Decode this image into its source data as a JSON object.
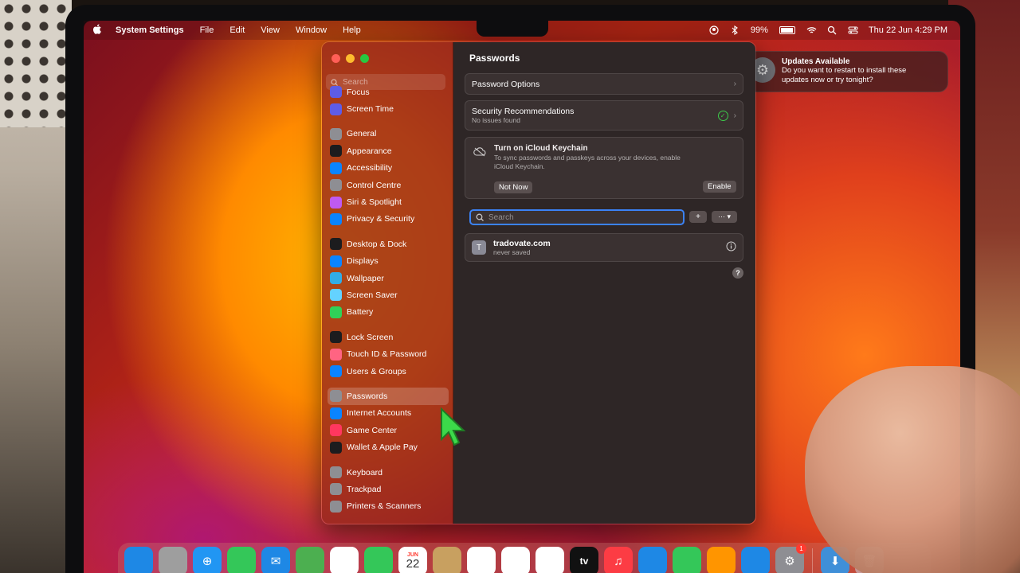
{
  "menubar": {
    "app_name": "System Settings",
    "menus": [
      "File",
      "Edit",
      "View",
      "Window",
      "Help"
    ],
    "battery": "99%",
    "datetime": "Thu 22 Jun  4:29 PM"
  },
  "sidebar": {
    "search_placeholder": "Search",
    "items": [
      {
        "label": "Focus",
        "icon": "moon-icon",
        "color": "#5e5ce6"
      },
      {
        "label": "Screen Time",
        "icon": "hourglass-icon",
        "color": "#5e5ce6"
      },
      {
        "label": "General",
        "icon": "gear-icon",
        "color": "#8e8e93"
      },
      {
        "label": "Appearance",
        "icon": "appearance-icon",
        "color": "#1c1c1e"
      },
      {
        "label": "Accessibility",
        "icon": "accessibility-icon",
        "color": "#0a84ff"
      },
      {
        "label": "Control Centre",
        "icon": "control-centre-icon",
        "color": "#8e8e93"
      },
      {
        "label": "Siri & Spotlight",
        "icon": "siri-icon",
        "color": "#bf5af2"
      },
      {
        "label": "Privacy & Security",
        "icon": "hand-icon",
        "color": "#0a84ff"
      },
      {
        "label": "Desktop & Dock",
        "icon": "dock-icon",
        "color": "#1c1c1e"
      },
      {
        "label": "Displays",
        "icon": "sun-icon",
        "color": "#0a84ff"
      },
      {
        "label": "Wallpaper",
        "icon": "wallpaper-icon",
        "color": "#32ade6"
      },
      {
        "label": "Screen Saver",
        "icon": "screensaver-icon",
        "color": "#64d2ff"
      },
      {
        "label": "Battery",
        "icon": "battery-icon",
        "color": "#30d158"
      },
      {
        "label": "Lock Screen",
        "icon": "lock-icon",
        "color": "#1c1c1e"
      },
      {
        "label": "Touch ID & Password",
        "icon": "fingerprint-icon",
        "color": "#ff6482"
      },
      {
        "label": "Users & Groups",
        "icon": "users-icon",
        "color": "#0a84ff"
      },
      {
        "label": "Passwords",
        "icon": "key-icon",
        "color": "#8e8e93"
      },
      {
        "label": "Internet Accounts",
        "icon": "at-icon",
        "color": "#0a84ff"
      },
      {
        "label": "Game Center",
        "icon": "game-center-icon",
        "color": "#ff375f"
      },
      {
        "label": "Wallet & Apple Pay",
        "icon": "wallet-icon",
        "color": "#1c1c1e"
      },
      {
        "label": "Keyboard",
        "icon": "keyboard-icon",
        "color": "#8e8e93"
      },
      {
        "label": "Trackpad",
        "icon": "trackpad-icon",
        "color": "#8e8e93"
      },
      {
        "label": "Printers & Scanners",
        "icon": "printer-icon",
        "color": "#8e8e93"
      }
    ]
  },
  "content": {
    "title": "Passwords",
    "password_options": "Password Options",
    "security": {
      "title": "Security Recommendations",
      "subtitle": "No issues found"
    },
    "keychain": {
      "title": "Turn on iCloud Keychain",
      "body_line1": "To sync passwords and passkeys across your devices, enable",
      "body_line2": "iCloud Keychain.",
      "not_now": "Not Now",
      "enable": "Enable"
    },
    "search_placeholder": "Search",
    "add_symbol": "+",
    "more_symbol": "··· ▾",
    "entries": [
      {
        "site": "tradovate.com",
        "status": "never saved",
        "avatar_letter": "T"
      }
    ],
    "help_symbol": "?"
  },
  "notification": {
    "title": "Updates Available",
    "body_line1": "Do you want to restart to install these",
    "body_line2": "updates now or try tonight?"
  },
  "dock": {
    "calendar_month": "JUN",
    "calendar_day": "22",
    "settings_badge": "1",
    "tv_label": "tv",
    "apps": [
      {
        "name": "finder-icon",
        "color": "#1e88e5"
      },
      {
        "name": "launchpad-icon",
        "color": "#9e9e9e"
      },
      {
        "name": "safari-icon",
        "color": "#2196f3"
      },
      {
        "name": "messages-icon",
        "color": "#34c759"
      },
      {
        "name": "mail-icon",
        "color": "#1e88e5"
      },
      {
        "name": "maps-icon",
        "color": "#4caf50"
      },
      {
        "name": "photos-icon",
        "color": "#ffffff"
      },
      {
        "name": "facetime-icon",
        "color": "#34c759"
      },
      {
        "name": "calendar-icon",
        "color": "#ffffff"
      },
      {
        "name": "contacts-icon",
        "color": "#c8a060"
      },
      {
        "name": "reminders-icon",
        "color": "#ffffff"
      },
      {
        "name": "notes-icon",
        "color": "#ffffff"
      },
      {
        "name": "freeform-icon",
        "color": "#ffffff"
      },
      {
        "name": "apple-tv-icon",
        "color": "#111111"
      },
      {
        "name": "music-icon",
        "color": "#fc3c44"
      },
      {
        "name": "keynote-icon",
        "color": "#1e88e5"
      },
      {
        "name": "numbers-icon",
        "color": "#34c759"
      },
      {
        "name": "pages-icon",
        "color": "#ff9500"
      },
      {
        "name": "app-store-icon",
        "color": "#1e88e5"
      },
      {
        "name": "system-settings-icon",
        "color": "#8e8e93"
      }
    ]
  }
}
